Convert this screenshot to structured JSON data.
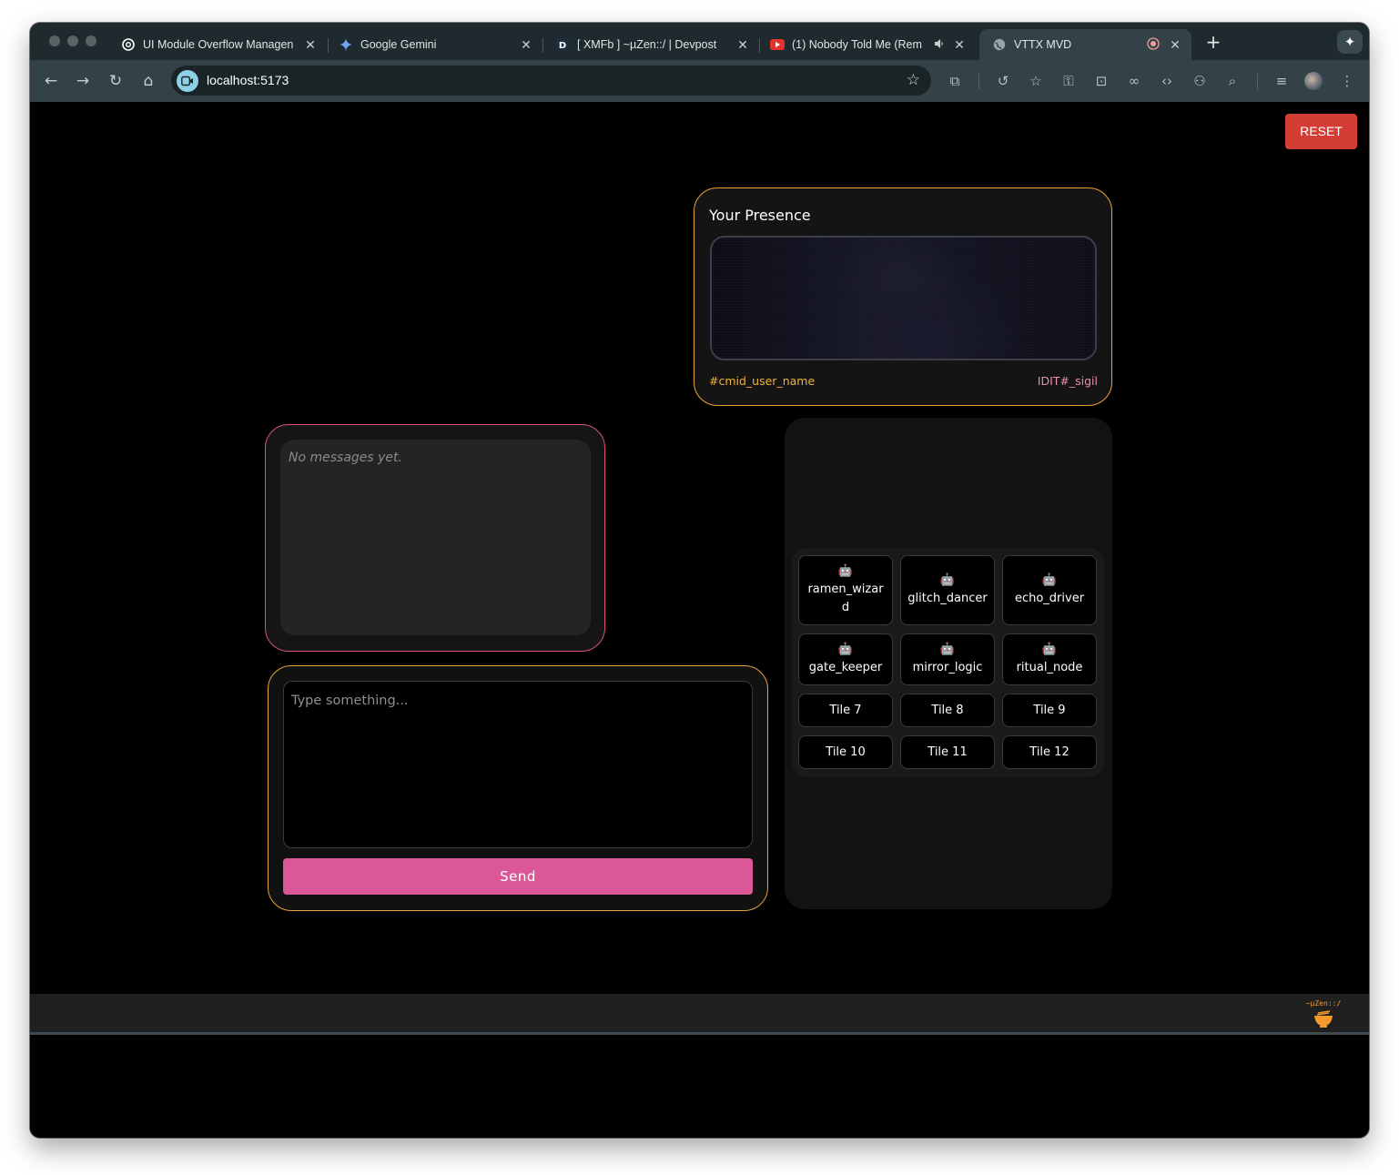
{
  "browser": {
    "tabs": [
      {
        "title": "UI Module Overflow Managen",
        "icon": "openai-icon",
        "close": "✕"
      },
      {
        "title": "Google Gemini",
        "icon": "gemini-icon",
        "close": "✕"
      },
      {
        "title": "[ XMFb ] ~µZen::/ | Devpost",
        "icon": "devpost-icon",
        "close": "✕"
      },
      {
        "title": "(1) Nobody Told Me (Rem",
        "icon": "youtube-icon",
        "close": "✕"
      },
      {
        "title": "VTTX MVD",
        "icon": "globe-icon",
        "close": "✕"
      }
    ],
    "new_tab_label": "+",
    "url": "localhost:5173"
  },
  "app": {
    "reset_label": "RESET",
    "presence": {
      "title": "Your Presence",
      "user_name": "#cmid_user_name",
      "sigil": "IDIT#_sigil"
    },
    "messages": {
      "empty_text": "No messages yet."
    },
    "composer": {
      "placeholder": "Type something...",
      "send_label": "Send"
    },
    "tiles": [
      {
        "label": "ramen_wizard",
        "icon": "robot-icon"
      },
      {
        "label": "glitch_dancer",
        "icon": "robot-icon"
      },
      {
        "label": "echo_driver",
        "icon": "robot-icon"
      },
      {
        "label": "gate_keeper",
        "icon": "robot-icon"
      },
      {
        "label": "mirror_logic",
        "icon": "robot-icon"
      },
      {
        "label": "ritual_node",
        "icon": "robot-icon"
      },
      {
        "label": "Tile 7"
      },
      {
        "label": "Tile 8"
      },
      {
        "label": "Tile 9"
      },
      {
        "label": "Tile 10"
      },
      {
        "label": "Tile 11"
      },
      {
        "label": "Tile 12"
      }
    ],
    "footer_logo_text": "~µZen::/"
  },
  "colors": {
    "accent_orange": "#e9a23b",
    "accent_pink": "#d94f8c",
    "send_pink": "#dc5797",
    "reset_red": "#d43d36"
  }
}
